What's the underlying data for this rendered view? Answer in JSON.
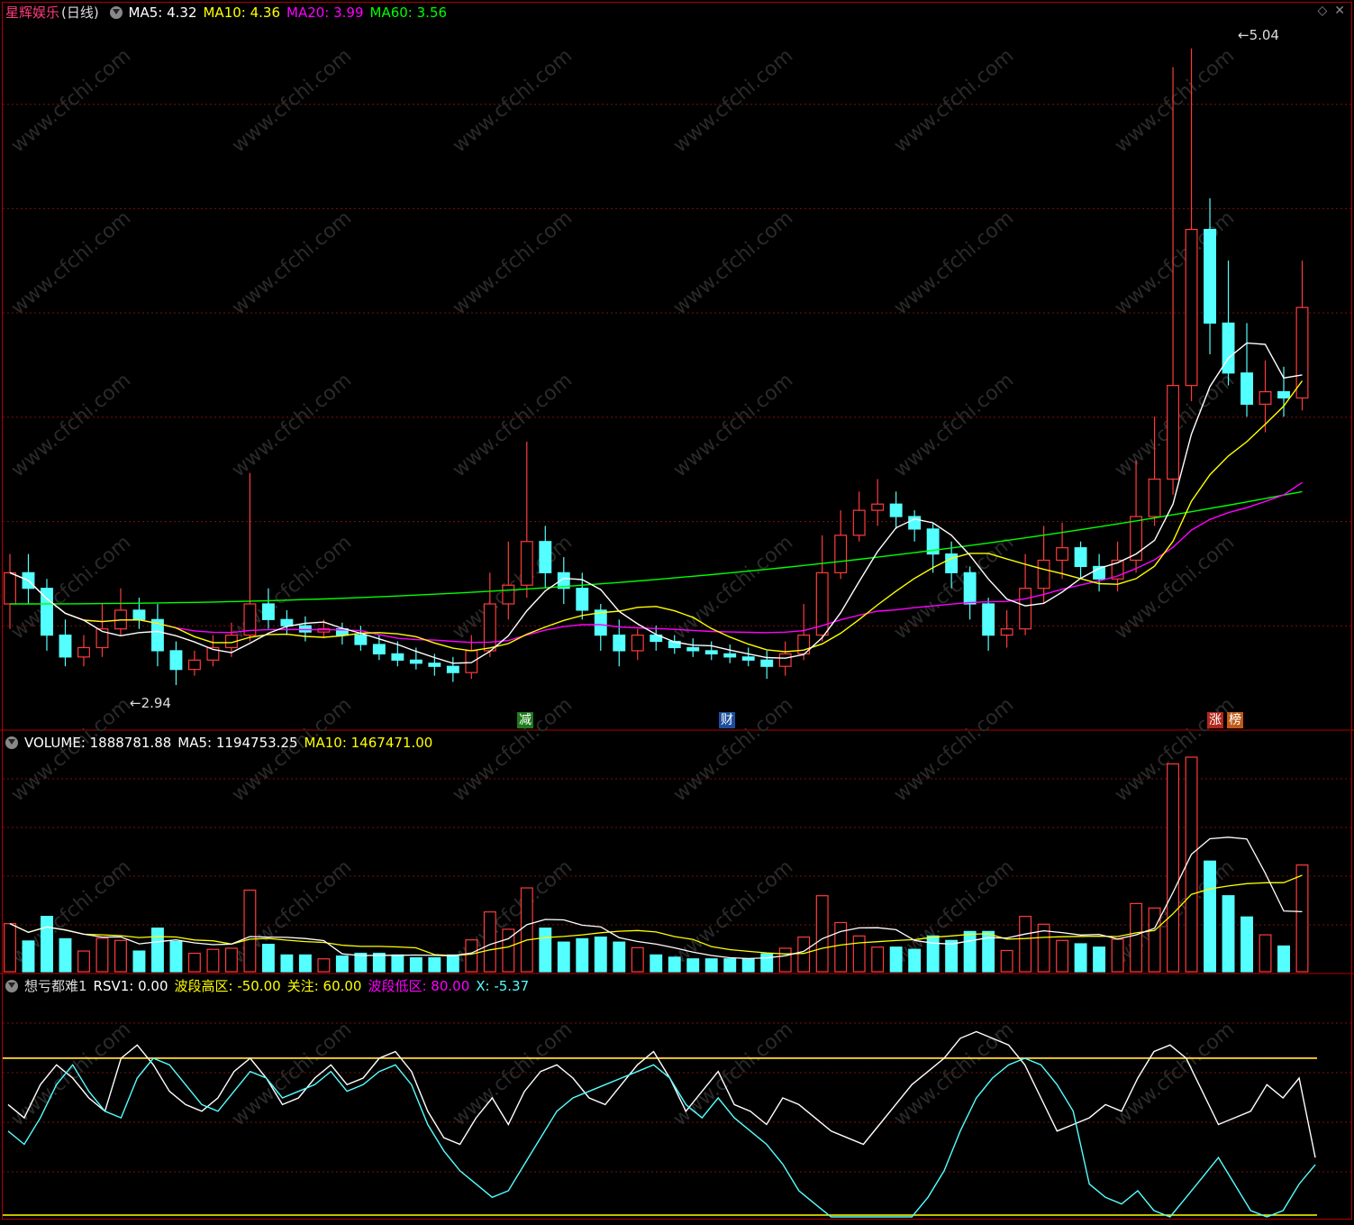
{
  "main": {
    "name": "星辉娱乐",
    "period": "(日线)",
    "ma": [
      {
        "label": "MA5: ",
        "value": "4.32",
        "color": "#ffffff"
      },
      {
        "label": "MA10: ",
        "value": "4.36",
        "color": "#ffff00"
      },
      {
        "label": "MA20: ",
        "value": "3.99",
        "color": "#ff00ff"
      },
      {
        "label": "MA60: ",
        "value": "3.56",
        "color": "#00ff00"
      }
    ],
    "high_label": "5.04",
    "low_label": "2.94",
    "tags": [
      "减",
      "财",
      "涨",
      "榜"
    ]
  },
  "volume": {
    "label": "VOLUME: 1888781.88",
    "ma5": "MA5: 1194753.25",
    "ma10": "MA10: 1467471.00"
  },
  "indicator": {
    "name": "想亏都难1",
    "rsv": "RSV1: 0.00",
    "high_zone": "波段高区: -50.00",
    "focus": "关注: 60.00",
    "low_zone": "波段低区: 80.00",
    "x": "X: -5.37"
  },
  "watermark": "www.cfchi.com",
  "colors": {
    "up": "#ff3b3b",
    "down": "#54ffff",
    "ma5": "#ffffff",
    "ma10": "#ffff00",
    "ma20": "#ff00ff",
    "ma60": "#00ff00",
    "grid": "#7a1010",
    "border": "#b00000"
  },
  "chart_data": [
    {
      "type": "candlestick",
      "title": "星辉娱乐 (日线)",
      "y_high": 5.04,
      "y_low": 2.94,
      "candles": [
        [
          3.2,
          3.3,
          3.12,
          3.36
        ],
        [
          3.3,
          3.25,
          3.2,
          3.36
        ],
        [
          3.25,
          3.1,
          3.05,
          3.28
        ],
        [
          3.1,
          3.03,
          3.0,
          3.15
        ],
        [
          3.03,
          3.06,
          3.0,
          3.1
        ],
        [
          3.06,
          3.12,
          3.03,
          3.2
        ],
        [
          3.12,
          3.18,
          3.1,
          3.25
        ],
        [
          3.18,
          3.15,
          3.12,
          3.22
        ],
        [
          3.15,
          3.05,
          3.0,
          3.2
        ],
        [
          3.05,
          2.99,
          2.94,
          3.08
        ],
        [
          2.99,
          3.02,
          2.97,
          3.05
        ],
        [
          3.02,
          3.06,
          3.0,
          3.1
        ],
        [
          3.06,
          3.1,
          3.03,
          3.14
        ],
        [
          3.1,
          3.2,
          3.08,
          3.62
        ],
        [
          3.2,
          3.15,
          3.12,
          3.25
        ],
        [
          3.15,
          3.13,
          3.1,
          3.18
        ],
        [
          3.13,
          3.11,
          3.08,
          3.16
        ],
        [
          3.11,
          3.12,
          3.09,
          3.15
        ],
        [
          3.12,
          3.1,
          3.07,
          3.14
        ],
        [
          3.1,
          3.07,
          3.05,
          3.13
        ],
        [
          3.07,
          3.04,
          3.02,
          3.1
        ],
        [
          3.04,
          3.02,
          3.0,
          3.08
        ],
        [
          3.02,
          3.01,
          2.99,
          3.06
        ],
        [
          3.01,
          3.0,
          2.97,
          3.04
        ],
        [
          3.0,
          2.98,
          2.95,
          3.03
        ],
        [
          2.98,
          3.05,
          2.96,
          3.1
        ],
        [
          3.05,
          3.2,
          3.03,
          3.3
        ],
        [
          3.2,
          3.26,
          3.15,
          3.4
        ],
        [
          3.26,
          3.4,
          3.22,
          3.72
        ],
        [
          3.4,
          3.3,
          3.25,
          3.45
        ],
        [
          3.3,
          3.25,
          3.2,
          3.35
        ],
        [
          3.25,
          3.18,
          3.15,
          3.3
        ],
        [
          3.18,
          3.1,
          3.05,
          3.2
        ],
        [
          3.1,
          3.05,
          3.0,
          3.15
        ],
        [
          3.05,
          3.1,
          3.02,
          3.12
        ],
        [
          3.1,
          3.08,
          3.05,
          3.13
        ],
        [
          3.08,
          3.06,
          3.04,
          3.1
        ],
        [
          3.06,
          3.05,
          3.03,
          3.09
        ],
        [
          3.05,
          3.04,
          3.02,
          3.08
        ],
        [
          3.04,
          3.03,
          3.01,
          3.07
        ],
        [
          3.03,
          3.02,
          3.0,
          3.06
        ],
        [
          3.02,
          3.0,
          2.96,
          3.05
        ],
        [
          3.0,
          3.04,
          2.97,
          3.08
        ],
        [
          3.04,
          3.1,
          3.02,
          3.2
        ],
        [
          3.1,
          3.3,
          3.08,
          3.42
        ],
        [
          3.3,
          3.42,
          3.28,
          3.5
        ],
        [
          3.42,
          3.5,
          3.4,
          3.56
        ],
        [
          3.5,
          3.52,
          3.45,
          3.6
        ],
        [
          3.52,
          3.48,
          3.44,
          3.56
        ],
        [
          3.48,
          3.44,
          3.4,
          3.5
        ],
        [
          3.44,
          3.36,
          3.3,
          3.46
        ],
        [
          3.36,
          3.3,
          3.25,
          3.4
        ],
        [
          3.3,
          3.2,
          3.15,
          3.32
        ],
        [
          3.2,
          3.1,
          3.05,
          3.22
        ],
        [
          3.1,
          3.12,
          3.06,
          3.18
        ],
        [
          3.12,
          3.25,
          3.1,
          3.36
        ],
        [
          3.25,
          3.34,
          3.2,
          3.45
        ],
        [
          3.34,
          3.38,
          3.28,
          3.46
        ],
        [
          3.38,
          3.32,
          3.28,
          3.4
        ],
        [
          3.32,
          3.28,
          3.24,
          3.36
        ],
        [
          3.28,
          3.34,
          3.24,
          3.4
        ],
        [
          3.34,
          3.48,
          3.3,
          3.66
        ],
        [
          3.48,
          3.6,
          3.45,
          3.8
        ],
        [
          3.6,
          3.9,
          3.55,
          4.92
        ],
        [
          3.9,
          4.4,
          3.85,
          4.98
        ],
        [
          4.4,
          4.1,
          4.0,
          4.5
        ],
        [
          4.1,
          3.94,
          3.9,
          4.3
        ],
        [
          3.94,
          3.84,
          3.8,
          4.1
        ],
        [
          3.84,
          3.88,
          3.75,
          3.98
        ],
        [
          3.88,
          3.86,
          3.8,
          3.96
        ],
        [
          3.86,
          4.15,
          3.82,
          4.3
        ]
      ],
      "ma60_start": 3.2,
      "ma60_end": 3.56
    },
    {
      "type": "bar",
      "title": "VOLUME",
      "current": 1888781.88,
      "ma5": 1194753.25,
      "ma10": 1467471.0
    },
    {
      "type": "line",
      "title": "想亏都难1",
      "series": [
        {
          "name": "RSV1",
          "values": [
            40,
            30,
            55,
            70,
            60,
            45,
            35,
            75,
            85,
            70,
            50,
            40,
            35,
            45,
            65,
            75,
            60,
            40,
            45,
            60,
            70,
            55,
            60,
            75,
            80,
            65,
            35,
            15,
            10,
            30,
            45,
            25,
            50,
            65,
            70,
            60,
            45,
            40,
            55,
            70,
            80,
            60,
            35,
            50,
            65,
            40,
            35,
            25,
            45,
            40,
            30,
            20,
            15,
            10,
            25,
            40,
            55,
            65,
            75,
            90,
            95,
            90,
            85,
            70,
            45,
            20,
            25,
            30,
            40,
            35,
            60,
            80,
            85,
            75,
            50,
            25,
            30,
            35,
            55,
            45,
            60,
            0
          ]
        },
        {
          "name": "X",
          "values": [
            20,
            10,
            30,
            55,
            70,
            50,
            35,
            30,
            60,
            75,
            70,
            55,
            40,
            35,
            50,
            65,
            60,
            45,
            50,
            55,
            65,
            50,
            55,
            65,
            70,
            55,
            25,
            5,
            -10,
            -20,
            -30,
            -25,
            -5,
            15,
            35,
            45,
            50,
            55,
            60,
            65,
            70,
            60,
            40,
            30,
            45,
            30,
            20,
            10,
            -5,
            -25,
            -35,
            -55,
            -75,
            -90,
            -95,
            -80,
            -55,
            -30,
            -10,
            20,
            45,
            60,
            70,
            75,
            70,
            55,
            35,
            -20,
            -30,
            -35,
            -25,
            -40,
            -50,
            -30,
            -15,
            0,
            -20,
            -40,
            -60,
            -40,
            -20,
            -5.37
          ]
        }
      ],
      "levels": {
        "high_zone": -50,
        "focus": 60,
        "low_zone": 80
      }
    }
  ]
}
